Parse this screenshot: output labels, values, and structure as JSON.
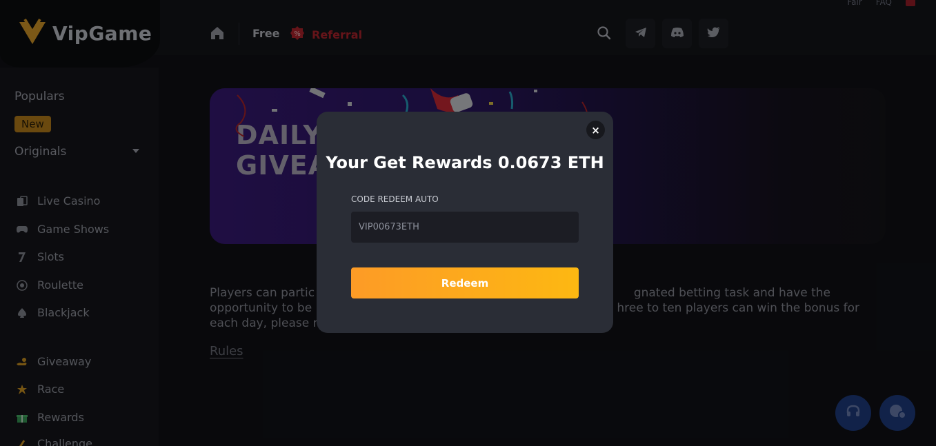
{
  "header": {
    "brand": "VipGame",
    "nav_free": "Free",
    "nav_referral": "Referral",
    "top_links": [
      "Fair",
      "FAQ"
    ]
  },
  "sidebar": {
    "populars": "Populars",
    "new_badge": "New",
    "originals": "Originals",
    "items_a": [
      {
        "label": "Live Casino",
        "icon": "cards-icon"
      },
      {
        "label": "Game Shows",
        "icon": "gamepad-icon"
      },
      {
        "label": "Slots",
        "icon": "seven-icon"
      },
      {
        "label": "Roulette",
        "icon": "roulette-icon"
      },
      {
        "label": "Blackjack",
        "icon": "spade-icon"
      }
    ],
    "items_b": [
      {
        "label": "Giveaway",
        "icon": "hand-coin-icon"
      },
      {
        "label": "Race",
        "icon": "star-icon"
      },
      {
        "label": "Rewards",
        "icon": "gift-icon"
      },
      {
        "label": "Challenge",
        "icon": "challenge-icon"
      }
    ]
  },
  "main": {
    "banner_title_1": "DAILY",
    "banner_title_2": "GIVEA",
    "desc_1": "Players can partic",
    "desc_1b": "gnated betting task and have the",
    "desc_2": "opportunity to be",
    "desc_2b": "hree to ten players can win the bonus for",
    "desc_3": "each day, please r",
    "rules": "Rules"
  },
  "modal": {
    "close": "×",
    "title": "Your Get Rewards 0.0673 ETH",
    "label": "CODE REDEEM AUTO",
    "code_value": "VIP00673ETH",
    "button": "Redeem"
  },
  "colors": {
    "accent_orange": "#fd9b26",
    "accent_yellow": "#fdb812",
    "referral_red": "#b8262f",
    "fab_blue": "#1f3e86"
  }
}
